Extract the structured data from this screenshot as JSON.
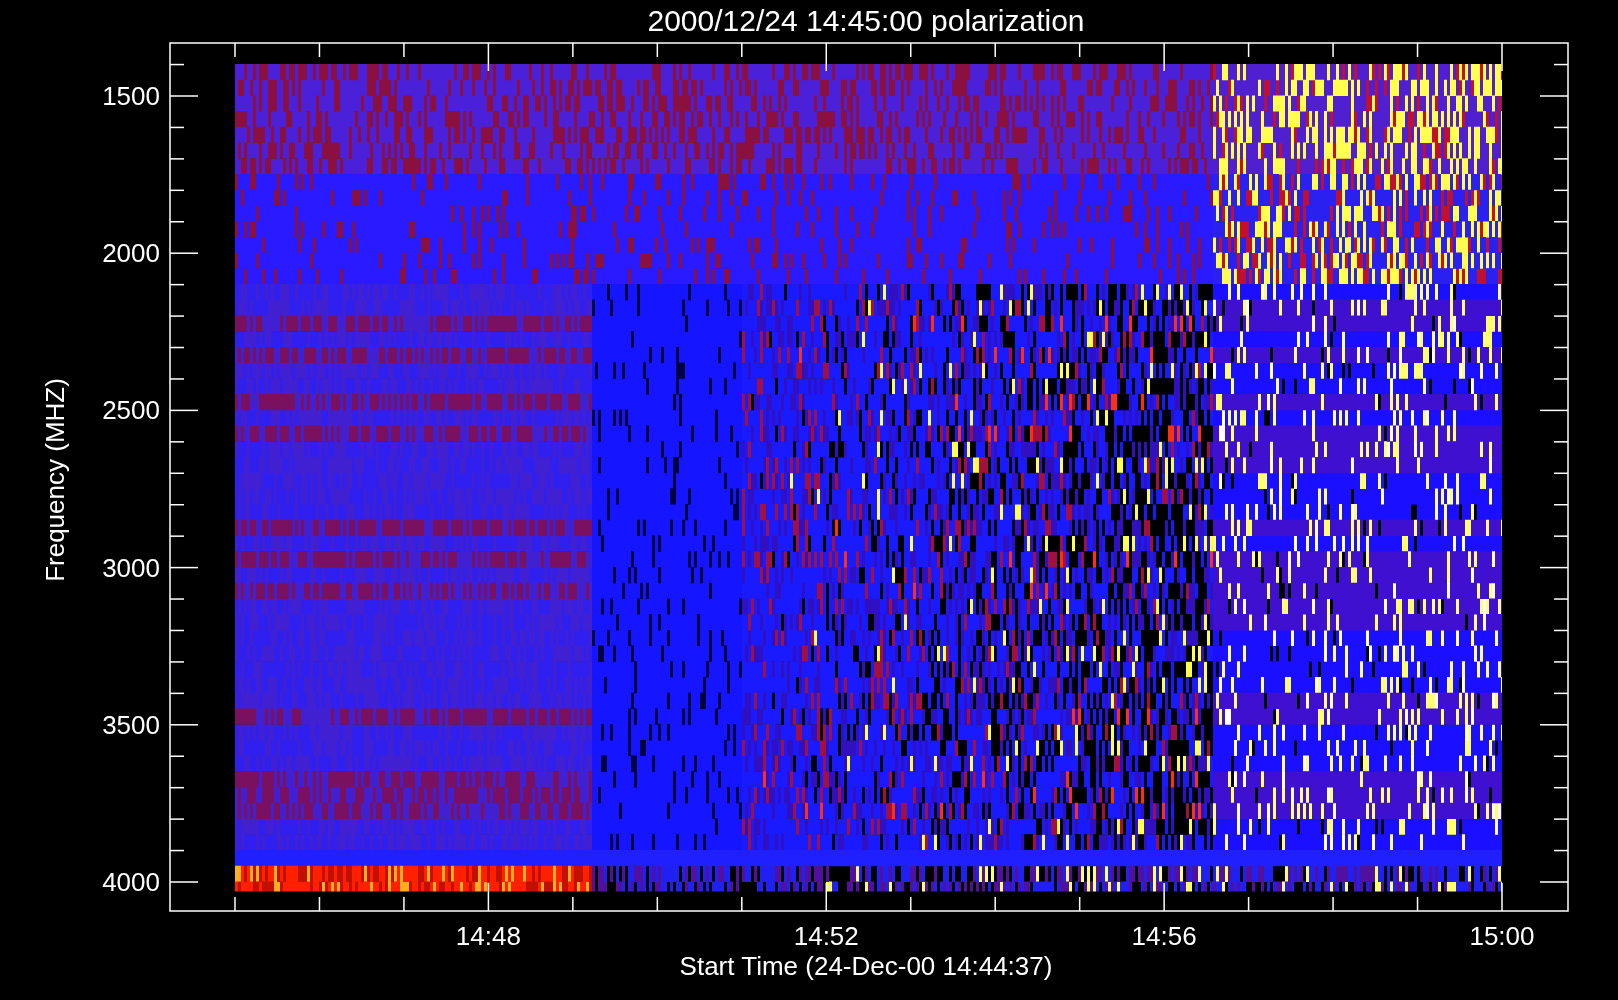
{
  "plot": {
    "title": "2000/12/24 14:45:00 polarization",
    "ylabel": "Frequency (MHZ)",
    "yticks": [
      "1500",
      "2000",
      "2500",
      "3000",
      "3500",
      "4000"
    ],
    "xticks": [
      "14:48",
      "14:52",
      "14:56",
      "15:00"
    ],
    "xlabel": "Start Time (24-Dec-00 14:44:37)"
  }
}
